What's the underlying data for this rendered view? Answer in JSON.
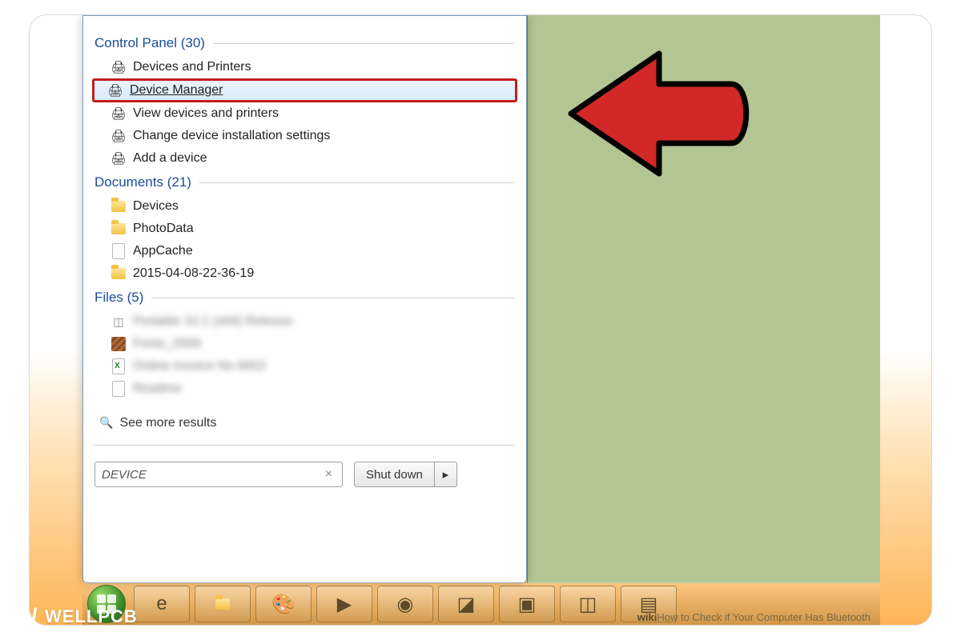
{
  "sections": {
    "control_panel": {
      "title": "Control Panel (30)"
    },
    "documents": {
      "title": "Documents (21)"
    },
    "files": {
      "title": "Files (5)"
    }
  },
  "control_panel_items": [
    {
      "label": "Devices and Printers"
    },
    {
      "label": "Device Manager"
    },
    {
      "label": "View devices and printers"
    },
    {
      "label": "Change device installation settings"
    },
    {
      "label": "Add a device"
    }
  ],
  "documents_items": [
    {
      "label": "Devices"
    },
    {
      "label": "PhotoData"
    },
    {
      "label": "AppCache"
    },
    {
      "label": "2015-04-08-22-36-19"
    }
  ],
  "files_items": [
    {
      "label": "Portable 10.1 (x64) Release"
    },
    {
      "label": "Fonts_2009"
    },
    {
      "label": "Online Invoice No 8452"
    },
    {
      "label": "Readme"
    }
  ],
  "see_more": "See more results",
  "search": {
    "value": "DEVICE",
    "clear_glyph": "×"
  },
  "shutdown": {
    "label": "Shut down",
    "arrow": "▸"
  },
  "taskbar_icons": [
    "start",
    "ie",
    "explorer",
    "paint",
    "media",
    "chrome",
    "notes",
    "screenshot",
    "vm",
    "app"
  ],
  "wiki": {
    "prefix": "wiki",
    "text": "How to Check if Your Computer Has Bluetooth"
  },
  "brand": "WELLPCB"
}
